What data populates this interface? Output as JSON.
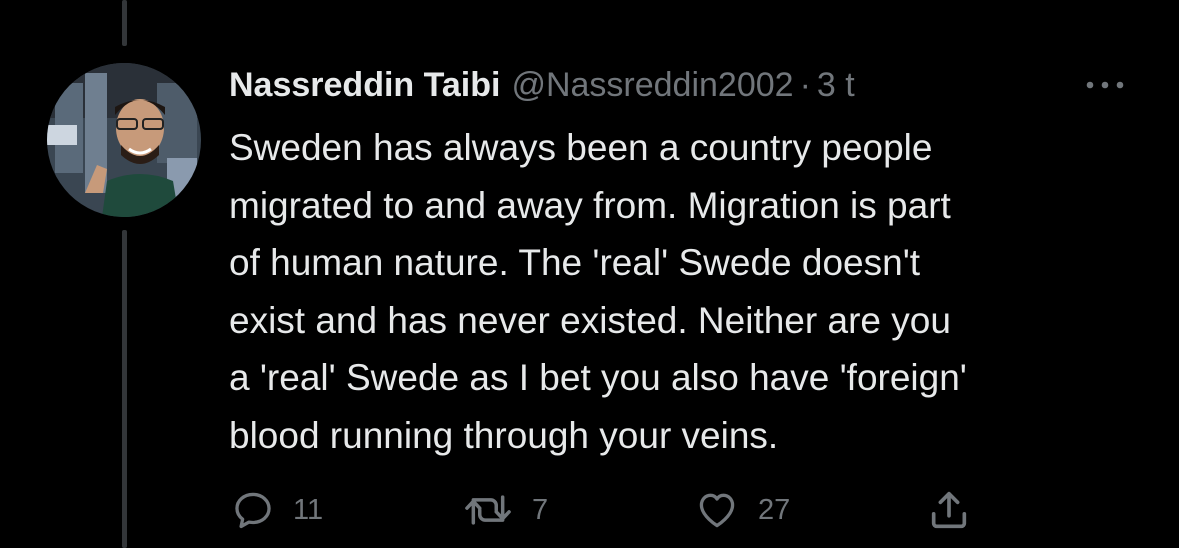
{
  "tweet": {
    "display_name": "Nassreddin Taibi",
    "handle": "@Nassreddin2002",
    "separator": "·",
    "time": "3 t",
    "text": "Sweden has always been a country people\nmigrated to and away from. Migration is part\nof human nature. The 'real' Swede doesn't\nexist and has never existed. Neither are you\na 'real' Swede as I bet you also have 'foreign'\nblood running through your veins."
  },
  "actions": {
    "reply_count": "11",
    "retweet_count": "7",
    "like_count": "27"
  },
  "icons": {
    "more": "more-horizontal-icon",
    "reply": "reply-icon",
    "retweet": "retweet-icon",
    "like": "heart-icon",
    "share": "share-icon"
  },
  "colors": {
    "background": "#000000",
    "text": "#e7e9ea",
    "secondary": "#71767b",
    "thread_line": "#333639"
  }
}
